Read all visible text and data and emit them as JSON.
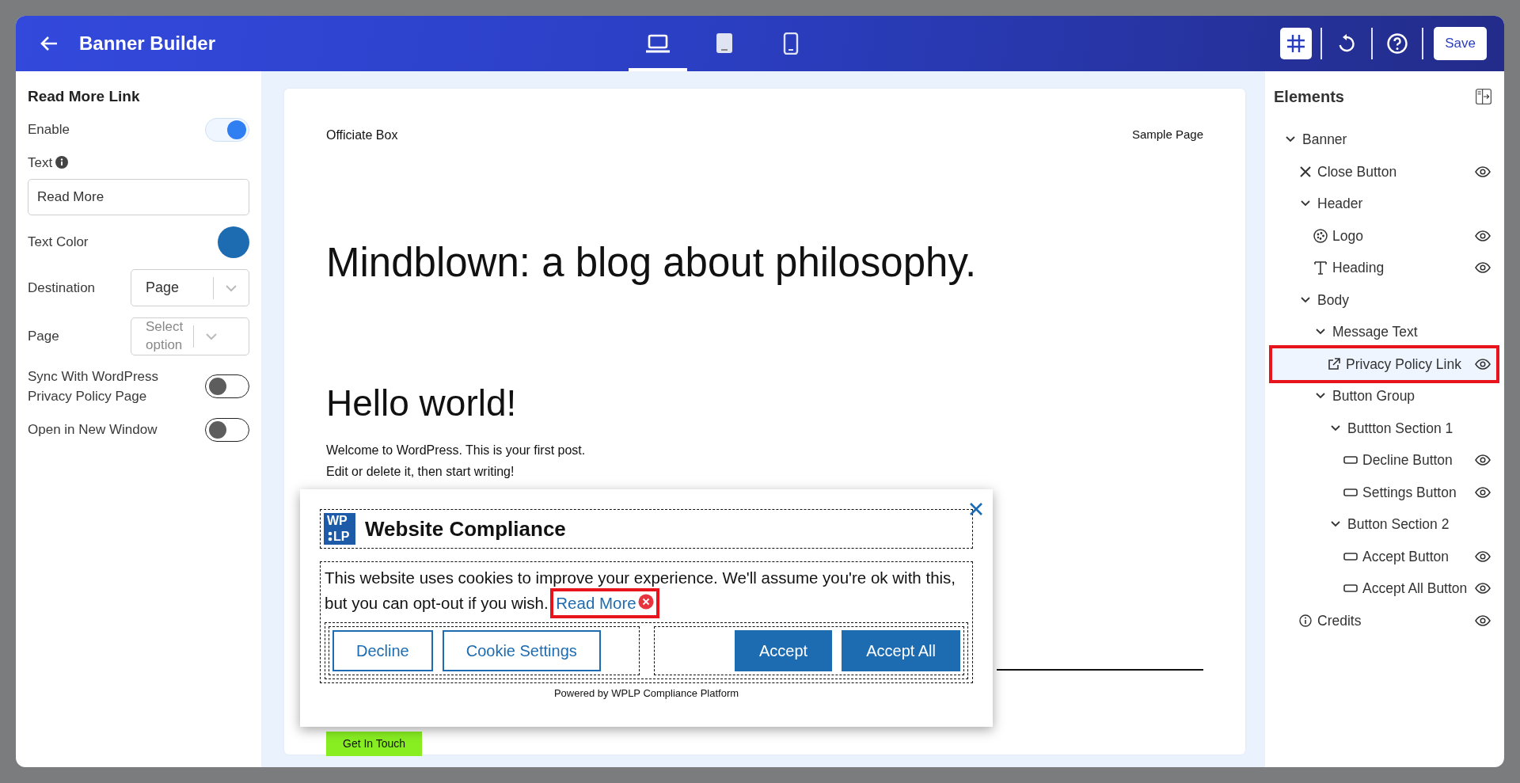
{
  "header": {
    "title": "Banner Builder",
    "devices": [
      {
        "kind": "laptop",
        "selected": true
      },
      {
        "kind": "tablet",
        "selected": false
      },
      {
        "kind": "phone",
        "selected": false
      }
    ],
    "grid_on": true,
    "save_label": "Save"
  },
  "settings": {
    "title": "Read More Link",
    "fields": [
      {
        "kind": "toggle",
        "label": "Enable",
        "on": true
      },
      {
        "kind": "text",
        "label": "Text",
        "info": true,
        "value": "Read More"
      },
      {
        "kind": "color",
        "label": "Text Color",
        "color": "#1d6bb0"
      },
      {
        "kind": "select",
        "label": "Destination",
        "value": "Page"
      },
      {
        "kind": "select",
        "label": "Page",
        "placeholder": "Select option"
      },
      {
        "kind": "toggle",
        "label": "Sync With WordPress Privacy Policy Page",
        "on": false
      },
      {
        "kind": "toggle",
        "label": "Open in New Window",
        "on": false
      }
    ]
  },
  "preview": {
    "site_title": "Officiate Box",
    "nav_link": "Sample Page",
    "page_title": "Mindblown: a blog about philosophy.",
    "post_title": "Hello world!",
    "post_lines": [
      "Welcome to WordPress. This is your first post.",
      "Edit or delete it, then start writing!"
    ],
    "cta": "Get In Touch"
  },
  "banner": {
    "logo_lines": [
      "WP",
      "LP"
    ],
    "title": "Website Compliance",
    "message": "This website uses cookies to improve your experience. We'll assume you're ok with this, but you can opt-out if you wish.",
    "read_more": "Read More",
    "sections": [
      {
        "buttons": [
          {
            "label": "Decline",
            "kind": "outline"
          },
          {
            "label": "Cookie Settings",
            "kind": "outline"
          }
        ]
      },
      {
        "buttons": [
          {
            "label": "Accept",
            "kind": "solid"
          },
          {
            "label": "Accept All",
            "kind": "solid"
          }
        ]
      }
    ],
    "powered_prefix": "Powered by",
    "powered_link": "WPLP Compliance Platform"
  },
  "elements": {
    "title": "Elements",
    "tree": [
      {
        "label": "Banner",
        "kind": "group",
        "selected": false,
        "children": [
          {
            "label": "Close Button",
            "kind": "close",
            "visible": true,
            "selected": false
          },
          {
            "label": "Header",
            "kind": "group",
            "selected": false,
            "children": [
              {
                "label": "Logo",
                "kind": "logo",
                "visible": true,
                "selected": false
              },
              {
                "label": "Heading",
                "kind": "heading",
                "visible": true,
                "selected": false
              }
            ]
          },
          {
            "label": "Body",
            "kind": "group",
            "selected": false,
            "children": [
              {
                "label": "Message Text",
                "kind": "group",
                "selected": false,
                "children": [
                  {
                    "label": "Privacy Policy Link",
                    "kind": "link",
                    "visible": true,
                    "selected": true
                  }
                ]
              },
              {
                "label": "Button Group",
                "kind": "group",
                "selected": false,
                "children": [
                  {
                    "label": "Buttton Section 1",
                    "kind": "group",
                    "selected": false,
                    "children": [
                      {
                        "label": "Decline Button",
                        "kind": "button",
                        "visible": true,
                        "selected": false
                      },
                      {
                        "label": "Settings Button",
                        "kind": "button",
                        "visible": true,
                        "selected": false
                      }
                    ]
                  },
                  {
                    "label": "Button Section 2",
                    "kind": "group",
                    "selected": false,
                    "children": [
                      {
                        "label": "Accept Button",
                        "kind": "button",
                        "visible": true,
                        "selected": false
                      },
                      {
                        "label": "Accept All Button",
                        "kind": "button",
                        "visible": true,
                        "selected": false
                      }
                    ]
                  }
                ]
              }
            ]
          },
          {
            "label": "Credits",
            "kind": "credits",
            "visible": true,
            "selected": false
          }
        ]
      }
    ]
  }
}
